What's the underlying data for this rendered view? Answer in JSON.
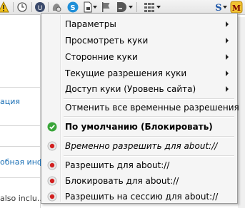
{
  "toolbar": {
    "icons": [
      "warning-icon",
      "clock-icon",
      "addon-icon",
      "skype-icon",
      "page-icon",
      "flag-icon",
      "bookmark-icon",
      "grid-icon",
      "s-icon",
      "m-icon"
    ]
  },
  "background": {
    "left_link_1": "ация",
    "left_link_2": "обная инф",
    "bottom_text": "also inclu..."
  },
  "menu": {
    "items": [
      {
        "label": "Параметры",
        "submenu": true
      },
      {
        "label": "Просмотреть куки",
        "submenu": true
      },
      {
        "label": "Сторонние куки",
        "submenu": true
      },
      {
        "label": "Текущие разрешения куки",
        "submenu": true
      },
      {
        "label": "Доступ куки (Уровень сайта)",
        "submenu": true
      },
      {
        "label": "Отменить все временные разрешения"
      },
      {
        "label": "По умолчанию (Блокировать)",
        "icon": "checkmark-icon"
      },
      {
        "label": "Временно разрешить для about://",
        "icon": "red-dot-icon"
      },
      {
        "label": "Разрешить для about://",
        "icon": "red-dot-icon"
      },
      {
        "label": "Блокировать для about://",
        "icon": "red-dot-icon"
      },
      {
        "label": "Разрешить на сессию для about://",
        "icon": "red-dot-icon"
      }
    ]
  },
  "colors": {
    "menu_bg": "#f5f5f5",
    "link": "#1a6fb5",
    "check_green": "#3aa53a",
    "dot_red": "#d22020"
  }
}
